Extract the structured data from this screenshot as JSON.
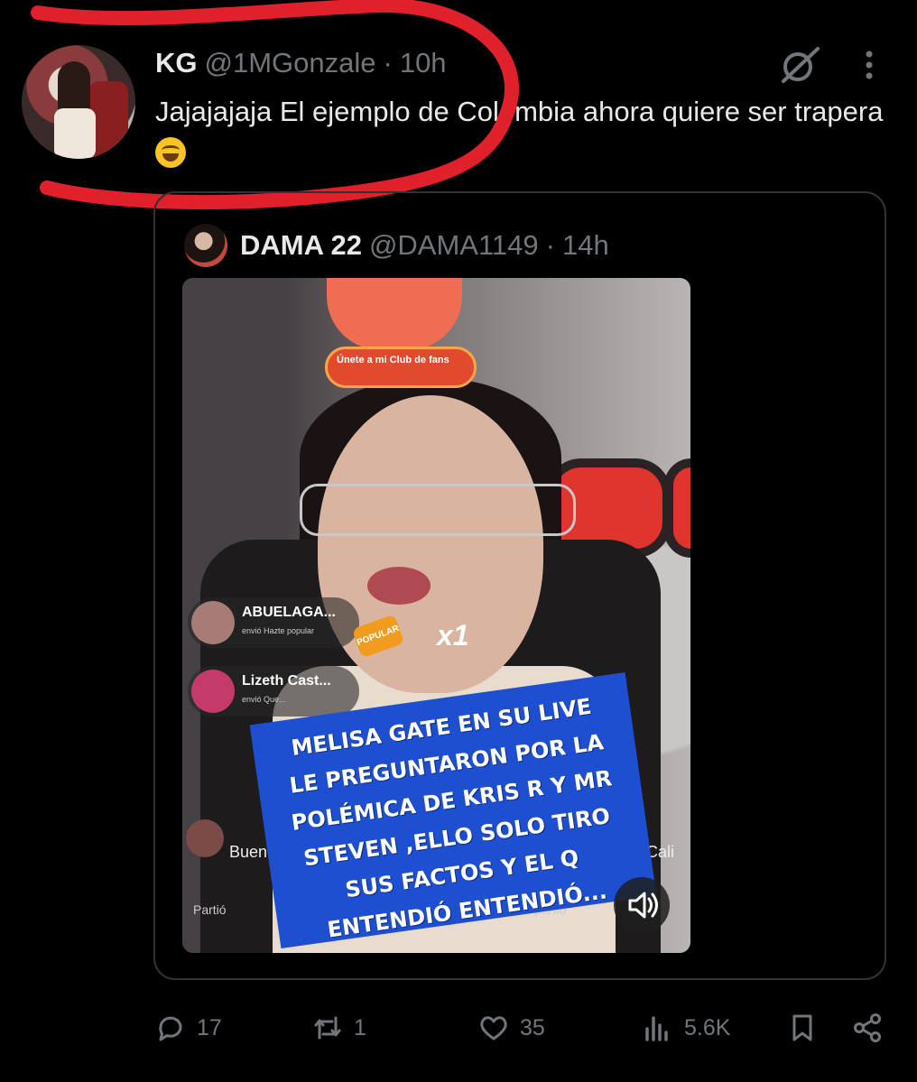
{
  "tweet": {
    "author_name": "KG",
    "author_handle": "@1MGonzale",
    "separator": "·",
    "time": "10h",
    "text": "Jajajajaja El ejemplo de Colombia ahora quiere ser trapera"
  },
  "quoted": {
    "author_name": "DAMA 22",
    "author_handle": "@DAMA1149",
    "separator": "·",
    "time": "14h",
    "media": {
      "club_banner": "Únete a mi Club de fans",
      "gift1_name": "ABUELAGA...",
      "gift1_sub": "envió Hazte popular",
      "gift2_name": "Lizeth Cast...",
      "gift2_sub": "envió Que...",
      "popular_badge": "POPULAR",
      "multiplier": "x1",
      "caption_lines": [
        "MELISA GATE EN SU LIVE",
        "LE PREGUNTARON POR LA",
        "POLÉMICA DE KRIS R Y MR",
        "STEVEN ,ELLO SOLO TIRO",
        "SUS FACTOS Y EL Q",
        "ENTENDIÓ ENTENDIÓ..."
      ],
      "comment_left": "Buen",
      "comment_right": "sde Cali",
      "share_left": "Partió",
      "share_right": "partió"
    }
  },
  "actions": {
    "replies": "17",
    "reposts": "1",
    "likes": "35",
    "views": "5.6K"
  },
  "icons": [
    "grok-icon",
    "more-icon",
    "reply-icon",
    "repost-icon",
    "like-icon",
    "views-icon",
    "bookmark-icon",
    "share-icon",
    "sound-icon"
  ],
  "colors": {
    "annotation": "#e0202a",
    "muted": "#71767b",
    "caption_bg": "#1f4fd1"
  }
}
